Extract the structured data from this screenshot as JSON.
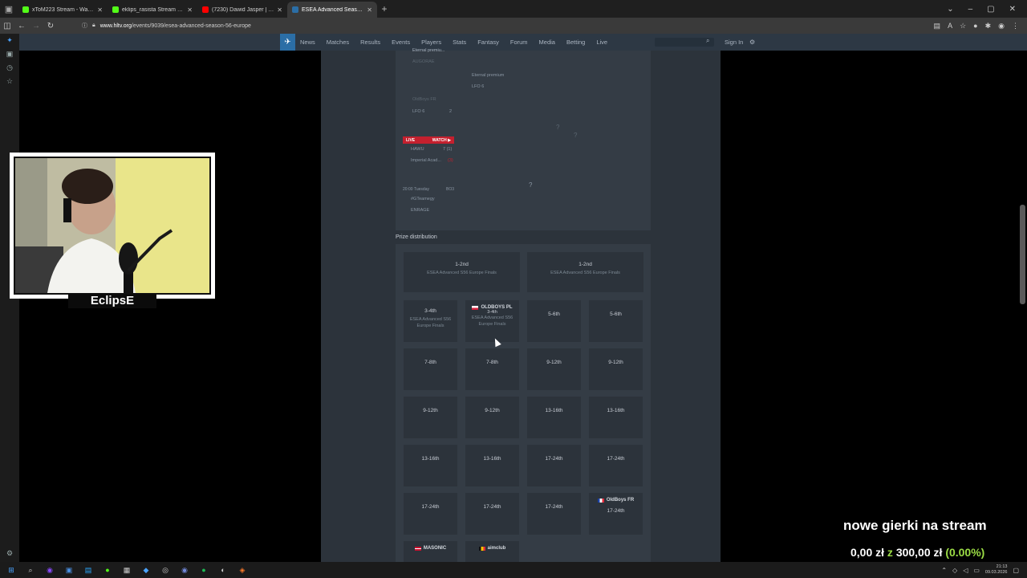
{
  "browser": {
    "tabs": [
      {
        "title": "xToM223 Stream - Watch Li",
        "color": "#53fc18",
        "active": false
      },
      {
        "title": "eklips_rasista Stream - Kick Da",
        "color": "#53fc18",
        "active": false
      },
      {
        "title": "(7230) Dawid Jasper | GRA W E",
        "color": "#ff0000",
        "active": false
      },
      {
        "title": "ESEA Advanced Season S6 Euro",
        "color": "#2b6ea6",
        "active": true
      }
    ],
    "url_host": "www.hltv.org",
    "url_path": "/events/9039/esea-advanced-season-56-europe"
  },
  "site_nav": {
    "items": [
      "News",
      "Matches",
      "Results",
      "Events",
      "Players",
      "Stats",
      "Fantasy",
      "Forum",
      "Media",
      "Betting",
      "Live"
    ],
    "sign_in": "Sign In"
  },
  "bracket": {
    "t1": "Eternal premiu...",
    "t2": "AUGORAE",
    "t3": "Eternal premium",
    "t4": "LFO 6",
    "t5": "OldBoys FR",
    "t6": "LFO 6",
    "s6": "2",
    "live_label": "LIVE",
    "watch_label": "WATCH ▶",
    "t7": "HAWU",
    "s7": "7 (1)",
    "t8": "Imperial Acad...",
    "s8": "(3)",
    "time": "20:00",
    "day": "Tuesday",
    "bo": "BO3",
    "t9": "#GTeamegy",
    "t10": "ENRAGE",
    "q": "?"
  },
  "prize": {
    "title": "Prize distribution",
    "event": "ESEA Advanced S56 Europe Finals",
    "rows": [
      [
        "1-2nd",
        "1-2nd"
      ],
      [
        "3-4th",
        "3-4th",
        "5-6th",
        "5-6th"
      ],
      [
        "7-8th",
        "7-8th",
        "9-12th",
        "9-12th"
      ],
      [
        "9-12th",
        "9-12th",
        "13-16th",
        "13-16th"
      ],
      [
        "13-16th",
        "13-16th",
        "17-24th",
        "17-24th"
      ],
      [
        "17-24th",
        "17-24th",
        "17-24th",
        "17-24th"
      ]
    ],
    "team_oldboys_pl": "OLDBOYS PL",
    "team_oldboys_fr": "OldBoys FR",
    "team_masonic": "MASONIC",
    "team_aimclub": "aimclub"
  },
  "stream": {
    "streamer_name": "EclipsE",
    "overlay_text": "nowe gierki na stream",
    "donation_current": "0,00 zł",
    "donation_sep": "z",
    "donation_goal": "300,00 zł",
    "donation_pct": "(0.00%)"
  },
  "clock": {
    "time": "21:13",
    "date": "09.03.2026"
  },
  "colors": {
    "site_nav": "#2d3844",
    "live_red": "#c4202e",
    "money_green": "#9bdc45"
  }
}
